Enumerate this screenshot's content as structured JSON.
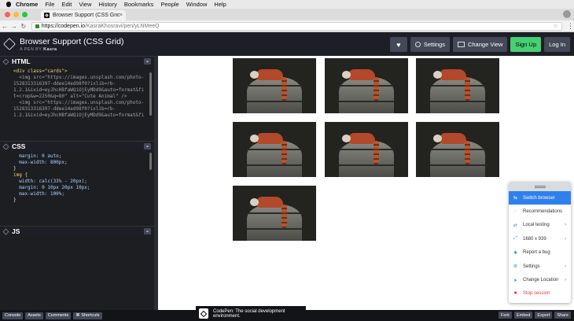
{
  "menubar": {
    "app": "Chrome",
    "items": [
      "File",
      "Edit",
      "View",
      "History",
      "Bookmarks",
      "People",
      "Window",
      "Help"
    ]
  },
  "browser": {
    "tab_title": "Browser Support (CSS Grid)",
    "url_host": "https://codepen.io",
    "url_path": "/KasraKhosravi/pen/yLNMeeQ"
  },
  "codepen": {
    "title": "Browser Support (CSS Grid)",
    "byline_prefix": "A PEN BY",
    "author": "Kasra",
    "buttons": {
      "heart": "♥",
      "settings": "Settings",
      "change_view": "Change View",
      "signup": "Sign Up",
      "login": "Log In"
    }
  },
  "editors": {
    "html": {
      "label": "HTML",
      "lines": [
        "<div class=\"cards\">",
        "",
        "  <img src=\"https://images.unsplash.com/photo-",
        "1528313316397-ddee14ed98f0?ixlib=rb-",
        "1.2.1&ixid=eyJhcHBfaWQiOjEyMDd9&auto=format&fi",
        "t=crop&w=2250&q=80\" alt=\"Cute Animal\" />",
        "",
        "  <img src=\"https://images.unsplash.com/photo-",
        "1528313316397-ddee14ed98f0?ixlib=rb-",
        "1.2.1&ixid=eyJhcHBfaWQiOjEyMDd9&auto=format&fi"
      ]
    },
    "css": {
      "label": "CSS",
      "lines": [
        "  margin: 0 auto;",
        "  max-width: 800px;",
        "}",
        "",
        "img {",
        "  width: calc(33% - 20px);",
        "  margin: 0 10px 20px 10px;",
        "  max-width: 100%;",
        "}"
      ]
    },
    "js": {
      "label": "JS",
      "lines": []
    }
  },
  "preview": {
    "image_alt": "Cute Animal",
    "image_count": 7
  },
  "lt_panel": {
    "items": [
      {
        "label": "Switch browser",
        "icon": "switch-icon",
        "chevron": false,
        "active": true
      },
      {
        "label": "Recommendations",
        "icon": "bulb-icon",
        "chevron": false
      },
      {
        "label": "Local testing",
        "icon": "local-icon",
        "chevron": true
      },
      {
        "label": "1680 x 939",
        "icon": "resize-icon",
        "chevron": true
      },
      {
        "label": "Report a bug",
        "icon": "bug-icon",
        "chevron": false
      },
      {
        "label": "Settings",
        "icon": "gear-icon",
        "chevron": true
      },
      {
        "label": "Change Location",
        "icon": "location-icon",
        "chevron": true
      },
      {
        "label": "Stop session",
        "icon": "stop-icon",
        "chevron": false,
        "stop": true
      }
    ]
  },
  "footer": {
    "left": [
      "Console",
      "Assets",
      "Comments",
      "⌘ Shortcuts"
    ],
    "toast": "CodePen: The social development environment.",
    "right": [
      "Fork",
      "Embed",
      "Export",
      "Share"
    ]
  },
  "colors": {
    "codepen_bg": "#1e1f26",
    "signup_green": "#47cf73",
    "lt_active": "#2f80ed",
    "stop_red": "#e03c3c"
  }
}
